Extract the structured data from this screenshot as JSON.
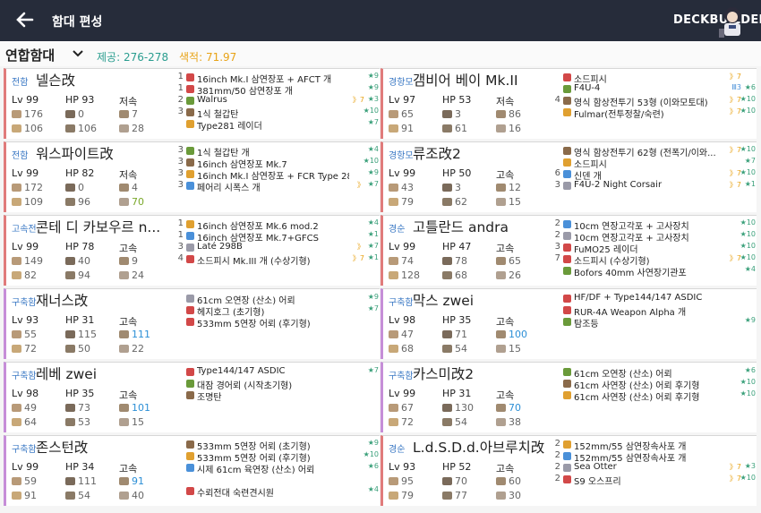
{
  "topbar": {
    "title": "함대 편성",
    "deck_label": "DECKBUILDER"
  },
  "fleet": {
    "name": "연합함대",
    "air_label": "제공: 276-278",
    "los_label": "색적: 71.97"
  },
  "labels": {
    "hp": "HP",
    "lv": "Lv"
  },
  "ships": [
    {
      "class": "전함",
      "name": "넬슨改",
      "lv": "Lv 99",
      "hp": "HP 93",
      "speed": "저속",
      "s1": "176",
      "s2": "0",
      "s3": "7",
      "s4": "106",
      "s5": "106",
      "s6": "28",
      "equip": [
        {
          "n": "1",
          "name": "16inch Mk.I 삼연장포 + AFCT 개",
          "lvl": "★9",
          "prof": ""
        },
        {
          "n": "1",
          "name": "381mm/50 삼연장포 개",
          "lvl": "★9",
          "prof": ""
        },
        {
          "n": "2",
          "name": "Walrus",
          "lvl": "★3",
          "prof": "》7"
        },
        {
          "n": "3",
          "name": "1식 철갑탄",
          "lvl": "★10",
          "prof": ""
        },
        {
          "n": "",
          "name": "Type281 레이더",
          "lvl": "★7",
          "prof": ""
        }
      ]
    },
    {
      "class": "경항모",
      "name": "갬비어 베이 Mk.II",
      "lv": "Lv 97",
      "hp": "HP 53",
      "speed": "저속",
      "s1": "65",
      "s2": "3",
      "s3": "86",
      "s4": "91",
      "s5": "61",
      "s6": "16",
      "equip": [
        {
          "n": "",
          "name": "소드피시",
          "lvl": "",
          "prof": "》7"
        },
        {
          "n": "",
          "name": "F4U-4",
          "lvl": "★6",
          "prof": "Ⅲ3"
        },
        {
          "n": "4",
          "name": "영식 함상전투기 53형 (이와모토대)",
          "lvl": "★10",
          "prof": "》7"
        },
        {
          "n": "",
          "name": "Fulmar(전투정찰/숙련)",
          "lvl": "★10",
          "prof": "》7"
        }
      ]
    },
    {
      "class": "전함",
      "name": "워스파이트改",
      "lv": "Lv 99",
      "hp": "HP 82",
      "speed": "저속",
      "s1": "172",
      "s2": "0",
      "s3": "4",
      "s4": "109",
      "s5": "96",
      "s6": "70",
      "equip": [
        {
          "n": "3",
          "name": "1식 철갑탄 개",
          "lvl": "★4",
          "prof": ""
        },
        {
          "n": "3",
          "name": "16inch 삼연장포 Mk.7",
          "lvl": "★10",
          "prof": ""
        },
        {
          "n": "3",
          "name": "16inch Mk.I 삼연장포 + FCR Type 284",
          "lvl": "★9",
          "prof": ""
        },
        {
          "n": "3",
          "name": "페어리 시폭스 개",
          "lvl": "★7",
          "prof": "》"
        }
      ]
    },
    {
      "class": "경항모",
      "name": "류조改2",
      "lv": "Lv 99",
      "hp": "HP 50",
      "speed": "고속",
      "s1": "43",
      "s2": "3",
      "s3": "12",
      "s4": "79",
      "s5": "62",
      "s6": "15",
      "equip": [
        {
          "n": "",
          "name": "영식 함상전투기 62형 (전폭기/이와...",
          "lvl": "★10",
          "prof": "》7"
        },
        {
          "n": "",
          "name": "소드피시",
          "lvl": "★7",
          "prof": ""
        },
        {
          "n": "6",
          "name": "신덴 개",
          "lvl": "★10",
          "prof": "》7"
        },
        {
          "n": "3",
          "name": "F4U-2 Night Corsair",
          "lvl": "★1",
          "prof": "》7"
        }
      ]
    },
    {
      "class": "고속전",
      "name": "콘테 디 카보우르 n...",
      "lv": "Lv 99",
      "hp": "HP 78",
      "speed": "고속",
      "s1": "149",
      "s2": "40",
      "s3": "9",
      "s4": "82",
      "s5": "94",
      "s6": "24",
      "equip": [
        {
          "n": "1",
          "name": "16inch 삼연장포 Mk.6 mod.2",
          "lvl": "★4",
          "prof": ""
        },
        {
          "n": "1",
          "name": "16inch 삼연장포 Mk.7+GFCS",
          "lvl": "★1",
          "prof": ""
        },
        {
          "n": "3",
          "name": "Laté 298B",
          "lvl": "★7",
          "prof": "》"
        },
        {
          "n": "4",
          "name": "소드피시 Mk.III 개 (수상기형)",
          "lvl": "★1",
          "prof": "》7"
        }
      ]
    },
    {
      "class": "경순",
      "name": "고틀란드 andra",
      "lv": "Lv 99",
      "hp": "HP 47",
      "speed": "고속",
      "s1": "74",
      "s2": "78",
      "s3": "65",
      "s4": "128",
      "s5": "68",
      "s6": "26",
      "equip": [
        {
          "n": "2",
          "name": "10cm 연장고각포 + 고사장치",
          "lvl": "★10",
          "prof": ""
        },
        {
          "n": "2",
          "name": "10cm 연장고각포 + 고사장치",
          "lvl": "★10",
          "prof": ""
        },
        {
          "n": "3",
          "name": "FuMO25 레이더",
          "lvl": "★10",
          "prof": ""
        },
        {
          "n": "7",
          "name": "소드피시 (수상기형)",
          "lvl": "★10",
          "prof": "》7"
        },
        {
          "n": "",
          "name": "Bofors 40mm 사연장기관포",
          "lvl": "★4",
          "prof": ""
        }
      ]
    },
    {
      "class": "구축함",
      "name": "재너스改",
      "lv": "Lv 93",
      "hp": "HP 31",
      "speed": "고속",
      "s1": "55",
      "s2": "115",
      "s3": "111",
      "s4": "72",
      "s5": "50",
      "s6": "22",
      "equip": [
        {
          "n": "",
          "name": "61cm 오연장 (산소) 어뢰",
          "lvl": "★9",
          "prof": ""
        },
        {
          "n": "",
          "name": "헤지호그 (초기형)",
          "lvl": "★7",
          "prof": ""
        },
        {
          "n": "",
          "name": "533mm 5연장 어뢰 (후기형)",
          "lvl": "",
          "prof": ""
        }
      ]
    },
    {
      "class": "구축함",
      "name": "막스 zwei",
      "lv": "Lv 98",
      "hp": "HP 35",
      "speed": "고속",
      "s1": "47",
      "s2": "71",
      "s3": "100",
      "s4": "68",
      "s5": "54",
      "s6": "15",
      "equip": [
        {
          "n": "",
          "name": "HF/DF + Type144/147 ASDIC",
          "lvl": "",
          "prof": ""
        },
        {
          "n": "",
          "name": "RUR-4A Weapon Alpha 개",
          "lvl": "",
          "prof": ""
        },
        {
          "n": "",
          "name": "탐조등",
          "lvl": "★9",
          "prof": ""
        }
      ]
    },
    {
      "class": "구축함",
      "name": "레베 zwei",
      "lv": "Lv 98",
      "hp": "HP 35",
      "speed": "고속",
      "s1": "49",
      "s2": "73",
      "s3": "101",
      "s4": "64",
      "s5": "53",
      "s6": "15",
      "equip": [
        {
          "n": "",
          "name": "Type144/147 ASDIC",
          "lvl": "★7",
          "prof": ""
        },
        {
          "n": "",
          "name": "대잠 경어뢰 (시작초기형)",
          "lvl": "",
          "prof": ""
        },
        {
          "n": "",
          "name": "조명탄",
          "lvl": "",
          "prof": ""
        }
      ]
    },
    {
      "class": "구축함",
      "name": "카스미改2",
      "lv": "Lv 99",
      "hp": "HP 31",
      "speed": "고속",
      "s1": "67",
      "s2": "130",
      "s3": "70",
      "s4": "72",
      "s5": "54",
      "s6": "38",
      "equip": [
        {
          "n": "",
          "name": "61cm 오연장 (산소) 어뢰",
          "lvl": "★6",
          "prof": ""
        },
        {
          "n": "",
          "name": "61cm 사연장 (산소) 어뢰 후기형",
          "lvl": "★10",
          "prof": ""
        },
        {
          "n": "",
          "name": "61cm 사연장 (산소) 어뢰 후기형",
          "lvl": "★10",
          "prof": ""
        }
      ]
    },
    {
      "class": "구축함",
      "name": "존스턴改",
      "lv": "Lv 99",
      "hp": "HP 34",
      "speed": "고속",
      "s1": "59",
      "s2": "111",
      "s3": "91",
      "s4": "91",
      "s5": "54",
      "s6": "40",
      "equip": [
        {
          "n": "",
          "name": "533mm 5연장 어뢰 (초기형)",
          "lvl": "★9",
          "prof": ""
        },
        {
          "n": "",
          "name": "533mm 5연장 어뢰 (후기형)",
          "lvl": "★10",
          "prof": ""
        },
        {
          "n": "",
          "name": "시제 61cm 육연장 (산소) 어뢰",
          "lvl": "★6",
          "prof": ""
        },
        {
          "n": "",
          "name": "",
          "lvl": "",
          "prof": ""
        },
        {
          "n": "",
          "name": "수뢰전대 숙련견시원",
          "lvl": "★4",
          "prof": ""
        }
      ]
    },
    {
      "class": "경순",
      "name": "L.d.S.D.d.아브루치改",
      "lv": "Lv 93",
      "hp": "HP 52",
      "speed": "고속",
      "s1": "95",
      "s2": "70",
      "s3": "60",
      "s4": "79",
      "s5": "77",
      "s6": "30",
      "equip": [
        {
          "n": "2",
          "name": "152mm/55 삼연장속사포 개",
          "lvl": "",
          "prof": ""
        },
        {
          "n": "2",
          "name": "152mm/55 삼연장속사포 개",
          "lvl": "",
          "prof": ""
        },
        {
          "n": "2",
          "name": "Sea Otter",
          "lvl": "★3",
          "prof": "》7"
        },
        {
          "n": "2",
          "name": "S9 오스프리",
          "lvl": "★10",
          "prof": "》7"
        }
      ]
    }
  ]
}
